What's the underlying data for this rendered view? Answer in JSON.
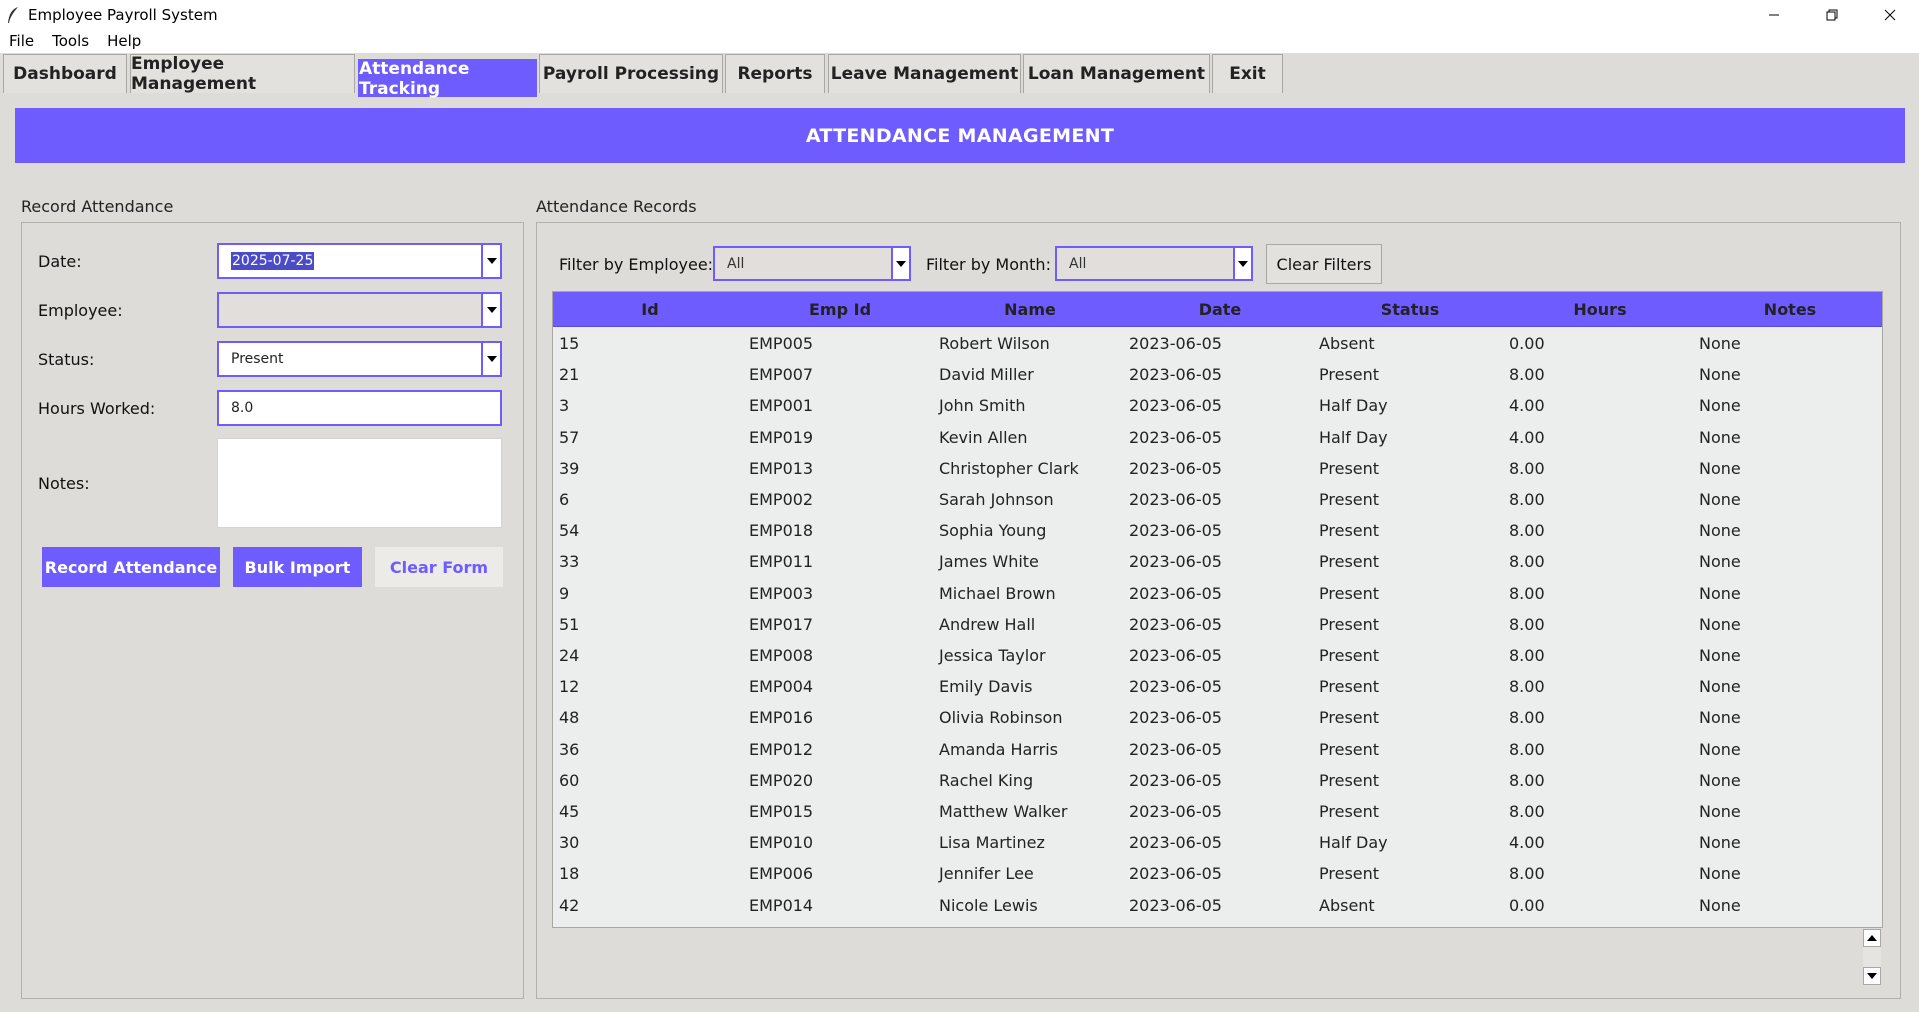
{
  "window": {
    "title": "Employee Payroll System"
  },
  "menu": [
    "File",
    "Tools",
    "Help"
  ],
  "tabs": [
    {
      "label": "Dashboard"
    },
    {
      "label": "Employee Management"
    },
    {
      "label": "Attendance Tracking",
      "active": true
    },
    {
      "label": "Payroll Processing"
    },
    {
      "label": "Reports"
    },
    {
      "label": "Leave Management"
    },
    {
      "label": "Loan Management"
    },
    {
      "label": "Exit"
    }
  ],
  "banner": {
    "title": "ATTENDANCE MANAGEMENT"
  },
  "record_form": {
    "section_title": "Record Attendance",
    "date_label": "Date:",
    "date_value": "2025-07-25",
    "employee_label": "Employee:",
    "employee_value": "",
    "status_label": "Status:",
    "status_value": "Present",
    "hours_label": "Hours Worked:",
    "hours_value": "8.0",
    "notes_label": "Notes:",
    "notes_value": "",
    "record_button": "Record Attendance",
    "bulk_button": "Bulk Import",
    "clear_button": "Clear Form"
  },
  "records": {
    "section_title": "Attendance Records",
    "filter_employee_label": "Filter by Employee:",
    "filter_employee_value": "All",
    "filter_month_label": "Filter by Month:",
    "filter_month_value": "All",
    "clear_filters_button": "Clear Filters",
    "columns": [
      "Id",
      "Emp Id",
      "Name",
      "Date",
      "Status",
      "Hours",
      "Notes"
    ],
    "rows": [
      [
        "15",
        "EMP005",
        "Robert Wilson",
        "2023-06-05",
        "Absent",
        "0.00",
        "None"
      ],
      [
        "21",
        "EMP007",
        "David Miller",
        "2023-06-05",
        "Present",
        "8.00",
        "None"
      ],
      [
        "3",
        "EMP001",
        "John Smith",
        "2023-06-05",
        "Half Day",
        "4.00",
        "None"
      ],
      [
        "57",
        "EMP019",
        "Kevin Allen",
        "2023-06-05",
        "Half Day",
        "4.00",
        "None"
      ],
      [
        "39",
        "EMP013",
        "Christopher Clark",
        "2023-06-05",
        "Present",
        "8.00",
        "None"
      ],
      [
        "6",
        "EMP002",
        "Sarah Johnson",
        "2023-06-05",
        "Present",
        "8.00",
        "None"
      ],
      [
        "54",
        "EMP018",
        "Sophia Young",
        "2023-06-05",
        "Present",
        "8.00",
        "None"
      ],
      [
        "33",
        "EMP011",
        "James White",
        "2023-06-05",
        "Present",
        "8.00",
        "None"
      ],
      [
        "9",
        "EMP003",
        "Michael Brown",
        "2023-06-05",
        "Present",
        "8.00",
        "None"
      ],
      [
        "51",
        "EMP017",
        "Andrew Hall",
        "2023-06-05",
        "Present",
        "8.00",
        "None"
      ],
      [
        "24",
        "EMP008",
        "Jessica Taylor",
        "2023-06-05",
        "Present",
        "8.00",
        "None"
      ],
      [
        "12",
        "EMP004",
        "Emily Davis",
        "2023-06-05",
        "Present",
        "8.00",
        "None"
      ],
      [
        "48",
        "EMP016",
        "Olivia Robinson",
        "2023-06-05",
        "Present",
        "8.00",
        "None"
      ],
      [
        "36",
        "EMP012",
        "Amanda Harris",
        "2023-06-05",
        "Present",
        "8.00",
        "None"
      ],
      [
        "60",
        "EMP020",
        "Rachel King",
        "2023-06-05",
        "Present",
        "8.00",
        "None"
      ],
      [
        "45",
        "EMP015",
        "Matthew Walker",
        "2023-06-05",
        "Present",
        "8.00",
        "None"
      ],
      [
        "30",
        "EMP010",
        "Lisa Martinez",
        "2023-06-05",
        "Half Day",
        "4.00",
        "None"
      ],
      [
        "18",
        "EMP006",
        "Jennifer Lee",
        "2023-06-05",
        "Present",
        "8.00",
        "None"
      ],
      [
        "42",
        "EMP014",
        "Nicole Lewis",
        "2023-06-05",
        "Absent",
        "0.00",
        "None"
      ]
    ]
  },
  "colors": {
    "accent": "#6e5cff",
    "background": "#dedcd8",
    "table_bg": "#eceeed"
  }
}
